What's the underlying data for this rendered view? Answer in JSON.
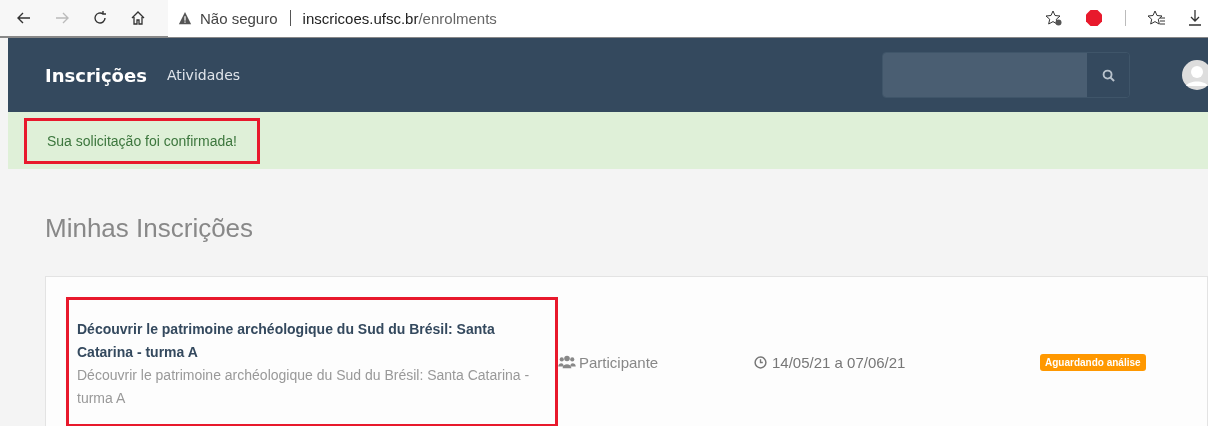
{
  "browser": {
    "security": "Não seguro",
    "url_host": "inscricoes.ufsc.br",
    "url_path": "/enrolments"
  },
  "navbar": {
    "brand": "Inscrições",
    "links": [
      "Atividades"
    ]
  },
  "alert": {
    "message": "Sua solicitação foi confirmada!",
    "highlighted": true
  },
  "page": {
    "title": "Minhas Inscrições"
  },
  "enrolments": [
    {
      "title": "Découvrir le patrimoine archéologique du Sud du Brésil: Santa Catarina - turma A",
      "subtitle": "Découvrir le patrimoine archéologique du Sud du Brésil: Santa Catarina - turma A",
      "highlighted": true,
      "role": "Participante",
      "dates": "14/05/21 a 07/06/21",
      "status": "Aguardando análise",
      "color": "#ff9800"
    }
  ]
}
